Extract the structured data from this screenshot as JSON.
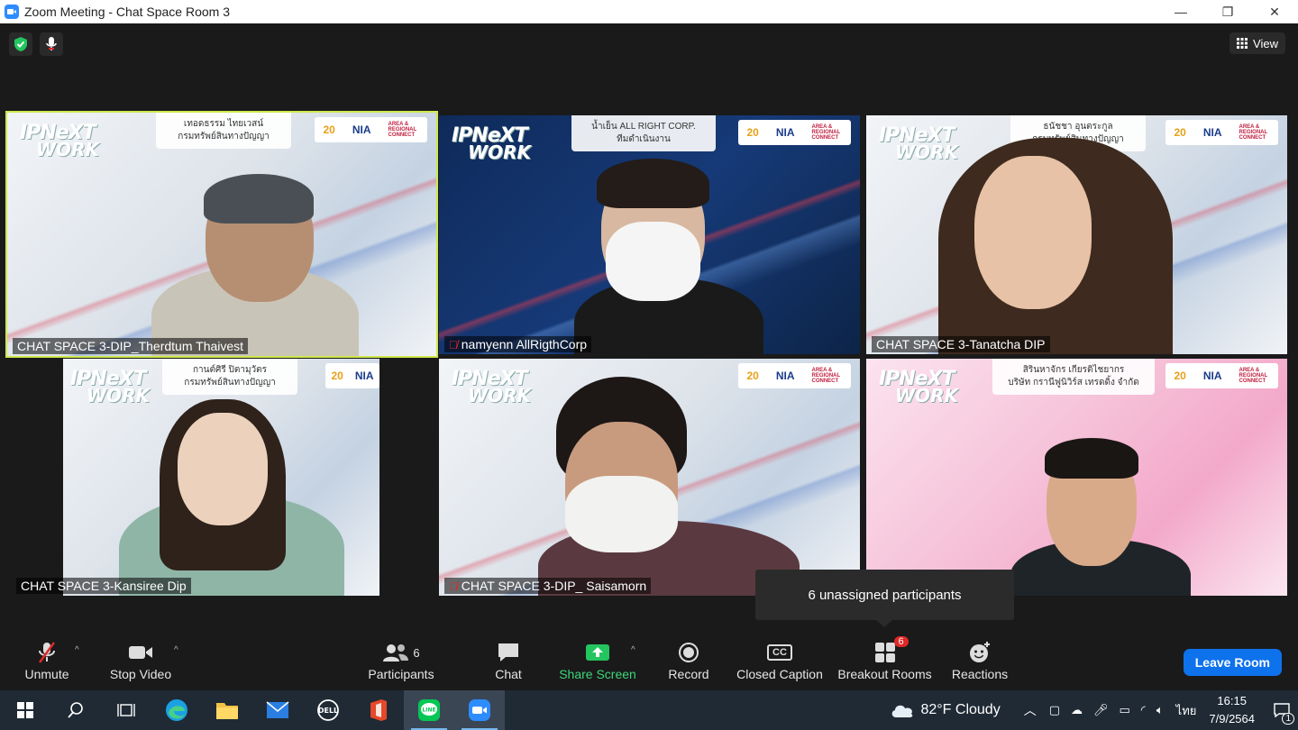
{
  "window": {
    "title": "Zoom Meeting - Chat Space Room 3",
    "minimize": "—",
    "maximize": "❐",
    "close": "✕"
  },
  "header": {
    "view_label": "View"
  },
  "tiles": [
    {
      "name": "CHAT SPACE 3-DIP_Therdtum Thaivest",
      "muted": false,
      "tag": "เทอดธรรม ไทยเวสน์\nกรมทรัพย์สินทางปัญญา",
      "active": true
    },
    {
      "name": "namyenn AllRigthCorp",
      "muted": true,
      "tag": "น้ำเย็น  ALL RIGHT CORP.\nทีมดำเนินงาน",
      "active": false
    },
    {
      "name": "CHAT SPACE 3-Tanatcha DIP",
      "muted": false,
      "tag": "ธนัชชา  อุนตระกูล\nกรมทรัพย์สินทางปัญญา",
      "active": false
    },
    {
      "name": "CHAT SPACE 3-Kansiree Dip",
      "muted": false,
      "tag": "กานต์ศิรี  ปิตามุวัตร\nกรมทรัพย์สินทางปัญญา",
      "active": false
    },
    {
      "name": "CHAT SPACE 3-DIP_ Saisamorn",
      "muted": true,
      "tag": "",
      "active": false
    },
    {
      "name": "",
      "muted": false,
      "tag": "สิรินหาจักร เกียรติไชยากร\nบริษัท กรานีฟูนิวิร์ส เทรดดิ้ง จำกัด",
      "active": false
    }
  ],
  "logo": {
    "line1": "IPNeXT",
    "line2": "WORK"
  },
  "sponsor": {
    "a": "20",
    "b": "NIA",
    "c": "AREA & REGIONAL CONNECT"
  },
  "toast": "6 unassigned participants",
  "toolbar": {
    "unmute": "Unmute",
    "stop_video": "Stop Video",
    "participants": "Participants",
    "participants_count": "6",
    "chat": "Chat",
    "share_screen": "Share Screen",
    "record": "Record",
    "closed_caption": "Closed Caption",
    "cc_icon": "CC",
    "breakout_rooms": "Breakout Rooms",
    "breakout_count": "6",
    "reactions": "Reactions",
    "leave_room": "Leave Room"
  },
  "taskbar": {
    "weather": "82°F  Cloudy",
    "lang": "ไทย",
    "time": "16:15",
    "date": "7/9/2564",
    "notifications": "1"
  },
  "colors": {
    "accent": "#0e72ed",
    "active_speaker": "#cfe84e",
    "share_green": "#3dd67a",
    "muted_red": "#e02828"
  }
}
